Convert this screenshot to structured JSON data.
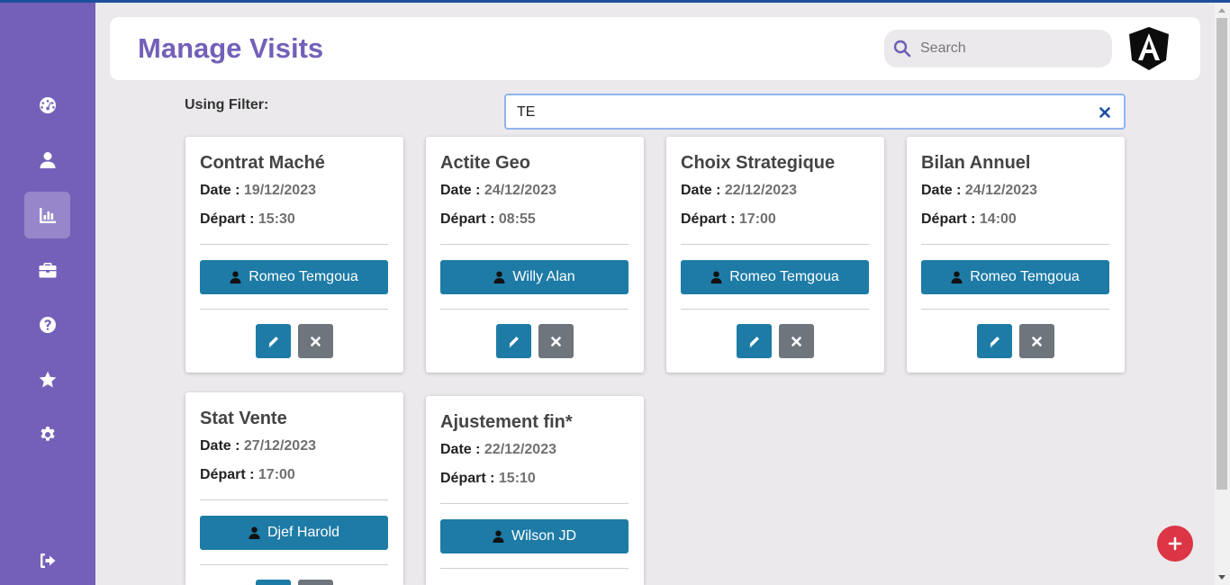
{
  "header": {
    "title": "Manage Visits",
    "search_placeholder": "Search"
  },
  "sidebar": {
    "items": [
      {
        "icon": "dashboard-icon"
      },
      {
        "icon": "user-icon"
      },
      {
        "icon": "chart-icon",
        "active": true
      },
      {
        "icon": "briefcase-icon"
      },
      {
        "icon": "help-icon"
      },
      {
        "icon": "star-icon"
      },
      {
        "icon": "gear-icon"
      },
      {
        "icon": "logout-icon"
      }
    ]
  },
  "filter": {
    "label": "Using Filter:",
    "value": "TE"
  },
  "labels": {
    "date": "Date :",
    "depart": "Départ :"
  },
  "visits": [
    {
      "title": "Contrat Maché",
      "date": "19/12/2023",
      "depart": "15:30",
      "person": "Romeo Temgoua"
    },
    {
      "title": "Actite Geo",
      "date": "24/12/2023",
      "depart": "08:55",
      "person": "Willy Alan"
    },
    {
      "title": "Choix Strategique",
      "date": "22/12/2023",
      "depart": "17:00",
      "person": "Romeo Temgoua"
    },
    {
      "title": "Bilan Annuel",
      "date": "24/12/2023",
      "depart": "14:00",
      "person": "Romeo Temgoua"
    },
    {
      "title": "Stat Vente",
      "date": "27/12/2023",
      "depart": "17:00",
      "person": "Djef Harold"
    },
    {
      "title": "Ajustement fin*",
      "date": "22/12/2023",
      "depart": "15:10",
      "person": "Wilson JD"
    }
  ],
  "colors": {
    "sidebar": "#7460b8",
    "accent": "#7460b8",
    "primary_button": "#1d7ba6",
    "secondary_button": "#6e757c",
    "fab": "#dc3545"
  }
}
